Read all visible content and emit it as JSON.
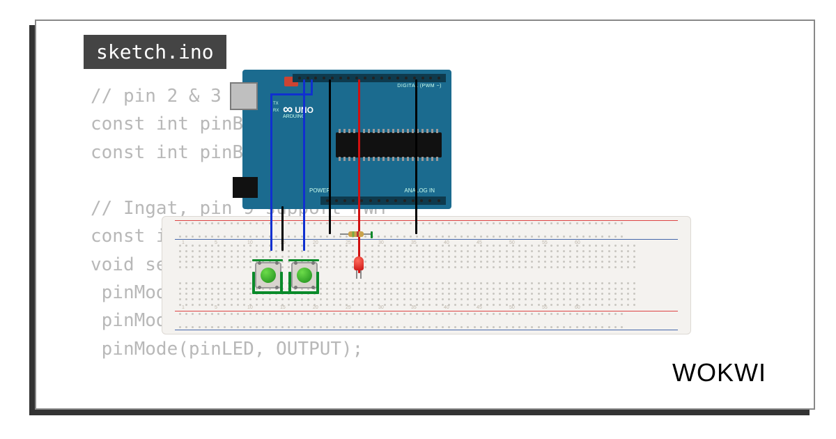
{
  "file": {
    "name": "sketch.ino"
  },
  "code": {
    "lines": [
      "// pin 2 & 3 sebag",
      "const int pinBt1",
      "const int pinBt2 =",
      "",
      "// Ingat, pin 9 support PWM",
      "const int pinLED",
      "void setup() {",
      " pinMode(pinBt1",
      " pinMode(pinBt2",
      " pinMode(pinLED, OUTPUT);"
    ]
  },
  "arduino": {
    "model": "UNO",
    "brand": "ARDUINO",
    "digital_label": "DIGITAL (PWM ~)",
    "power_label": "POWER",
    "analog_label": "ANALOG IN",
    "tx": "TX",
    "rx": "RX"
  },
  "breadboard": {
    "col_labels": [
      "1",
      "5",
      "10",
      "15",
      "20",
      "25",
      "30",
      "35",
      "40",
      "45",
      "50",
      "55",
      "60"
    ]
  },
  "brand": "WOKWI",
  "components": {
    "button1": "btn1",
    "button2": "btn2",
    "led": "led-red",
    "resistor": "r1"
  },
  "wires": {
    "d2_to_bb": {
      "color": "blue"
    },
    "d3_to_bb": {
      "color": "blue"
    },
    "gnd_to_bb": {
      "color": "black"
    },
    "gnd_rail": {
      "color": "black"
    },
    "d9_to_bb": {
      "color": "red"
    },
    "gnd_rail2": {
      "color": "black"
    },
    "btn_traces": {
      "color": "green"
    }
  }
}
